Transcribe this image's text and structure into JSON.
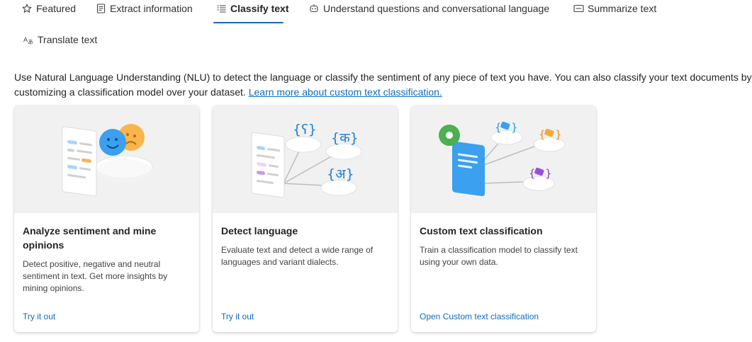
{
  "tabs": [
    {
      "label": "Featured",
      "icon": "star-icon"
    },
    {
      "label": "Extract information",
      "icon": "document-icon"
    },
    {
      "label": "Classify text",
      "icon": "text-list-icon",
      "active": true
    },
    {
      "label": "Understand questions and conversational language",
      "icon": "chat-bot-icon"
    },
    {
      "label": "Summarize text",
      "icon": "summary-icon"
    },
    {
      "label": "Translate text",
      "icon": "translate-icon"
    }
  ],
  "intro": {
    "text": "Use Natural Language Understanding (NLU) to detect the language or classify the sentiment of any piece of text you have. You can also classify your text documents by",
    "text2": "customizing a classification model over your dataset. ",
    "link": "Learn more about custom text classification."
  },
  "cards": [
    {
      "title": "Analyze sentiment and mine opinions",
      "description": "Detect positive, negative and neutral sentiment in text. Get more insights by mining opinions.",
      "cta": "Try it out"
    },
    {
      "title": "Detect language",
      "description": "Evaluate text and detect a wide range of languages and variant dialects.",
      "cta": "Try it out",
      "glyphs": [
        "{ʕ}",
        "{क}",
        "{अ}"
      ]
    },
    {
      "title": "Custom text classification",
      "description": "Train a classification model to classify text using your own data.",
      "cta": "Open Custom text classification"
    }
  ],
  "colors": {
    "accent": "#0f6cbd",
    "card_art_bg": "#f1f1f1"
  }
}
